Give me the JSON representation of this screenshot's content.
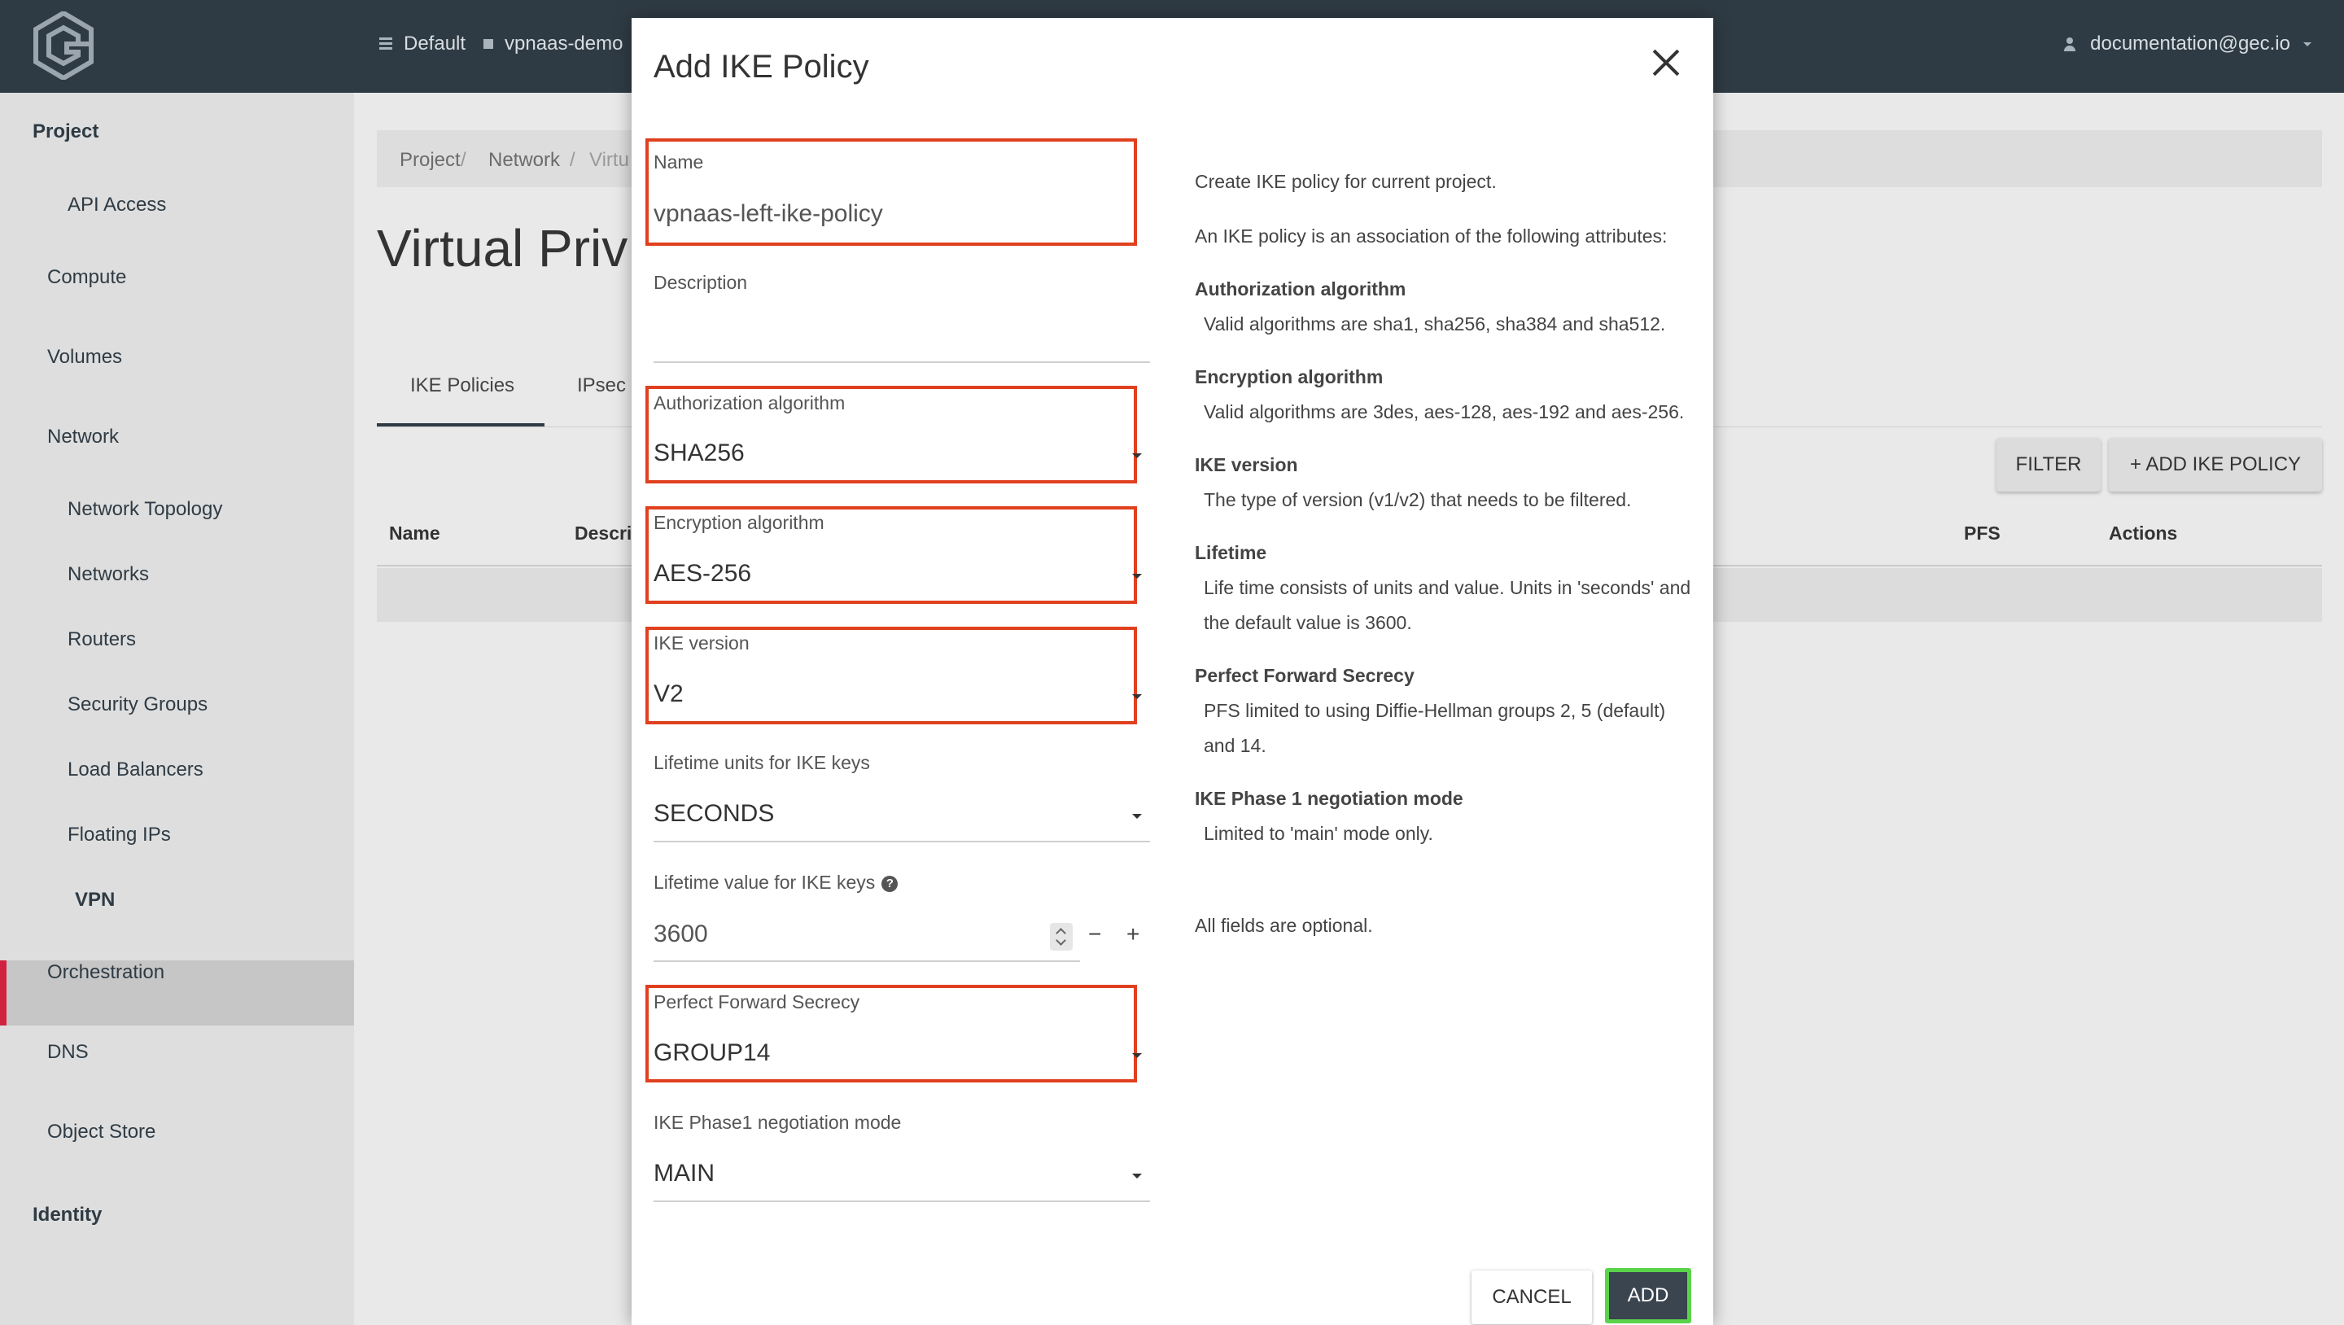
{
  "topbar": {
    "domain": "Default",
    "project": "vpnaas-demo",
    "user": "documentation@gec.io"
  },
  "sidebar": {
    "sections": [
      {
        "label": "Project"
      },
      {
        "label": "API Access"
      },
      {
        "label": "Compute"
      },
      {
        "label": "Volumes"
      },
      {
        "label": "Network"
      },
      {
        "label": "Network Topology"
      },
      {
        "label": "Networks"
      },
      {
        "label": "Routers"
      },
      {
        "label": "Security Groups"
      },
      {
        "label": "Load Balancers"
      },
      {
        "label": "Floating IPs"
      },
      {
        "label": "VPN"
      },
      {
        "label": "Orchestration"
      },
      {
        "label": "DNS"
      },
      {
        "label": "Object Store"
      },
      {
        "label": "Identity"
      }
    ]
  },
  "main": {
    "breadcrumb": [
      "Project",
      "Network",
      "Virtu"
    ],
    "title": "Virtual Priv",
    "tabs": [
      "IKE Policies",
      "IPsec"
    ],
    "filter_button": "FILTER",
    "add_button": "+ ADD IKE POLICY",
    "columns": [
      "Name",
      "Descri",
      "PFS",
      "Actions"
    ]
  },
  "modal": {
    "title": "Add IKE Policy",
    "fields": {
      "name": {
        "label": "Name",
        "value": "vpnaas-left-ike-policy"
      },
      "description": {
        "label": "Description",
        "value": ""
      },
      "auth": {
        "label": "Authorization algorithm",
        "value": "SHA256"
      },
      "enc": {
        "label": "Encryption algorithm",
        "value": "AES-256"
      },
      "ike_version": {
        "label": "IKE version",
        "value": "V2"
      },
      "lifetime_units": {
        "label": "Lifetime units for IKE keys",
        "value": "SECONDS"
      },
      "lifetime_value": {
        "label": "Lifetime value for IKE keys",
        "value": "3600"
      },
      "pfs": {
        "label": "Perfect Forward Secrecy",
        "value": "GROUP14"
      },
      "phase1": {
        "label": "IKE Phase1 negotiation mode",
        "value": "MAIN"
      }
    },
    "stepper": {
      "minus": "−",
      "plus": "+"
    },
    "help": {
      "intro": "Create IKE policy for current project.",
      "assoc": "An IKE policy is an association of the following attributes:",
      "auth_h": "Authorization algorithm",
      "auth_t": "Valid algorithms are sha1, sha256, sha384 and sha512.",
      "enc_h": "Encryption algorithm",
      "enc_t": "Valid algorithms are 3des, aes-128, aes-192 and aes-256.",
      "ver_h": "IKE version",
      "ver_t": "The type of version (v1/v2) that needs to be filtered.",
      "life_h": "Lifetime",
      "life_t": "Life time consists of units and value. Units in 'seconds' and the default value is 3600.",
      "pfs_h": "Perfect Forward Secrecy",
      "pfs_t": "PFS limited to using Diffie-Hellman groups 2, 5 (default) and 14.",
      "p1_h": "IKE Phase 1 negotiation mode",
      "p1_t": "Limited to 'main' mode only.",
      "optional": "All fields are optional."
    },
    "cancel": "CANCEL",
    "add": "ADD",
    "colors": {
      "highlight": "#e0401f",
      "add_outline": "#5ad34a"
    }
  }
}
